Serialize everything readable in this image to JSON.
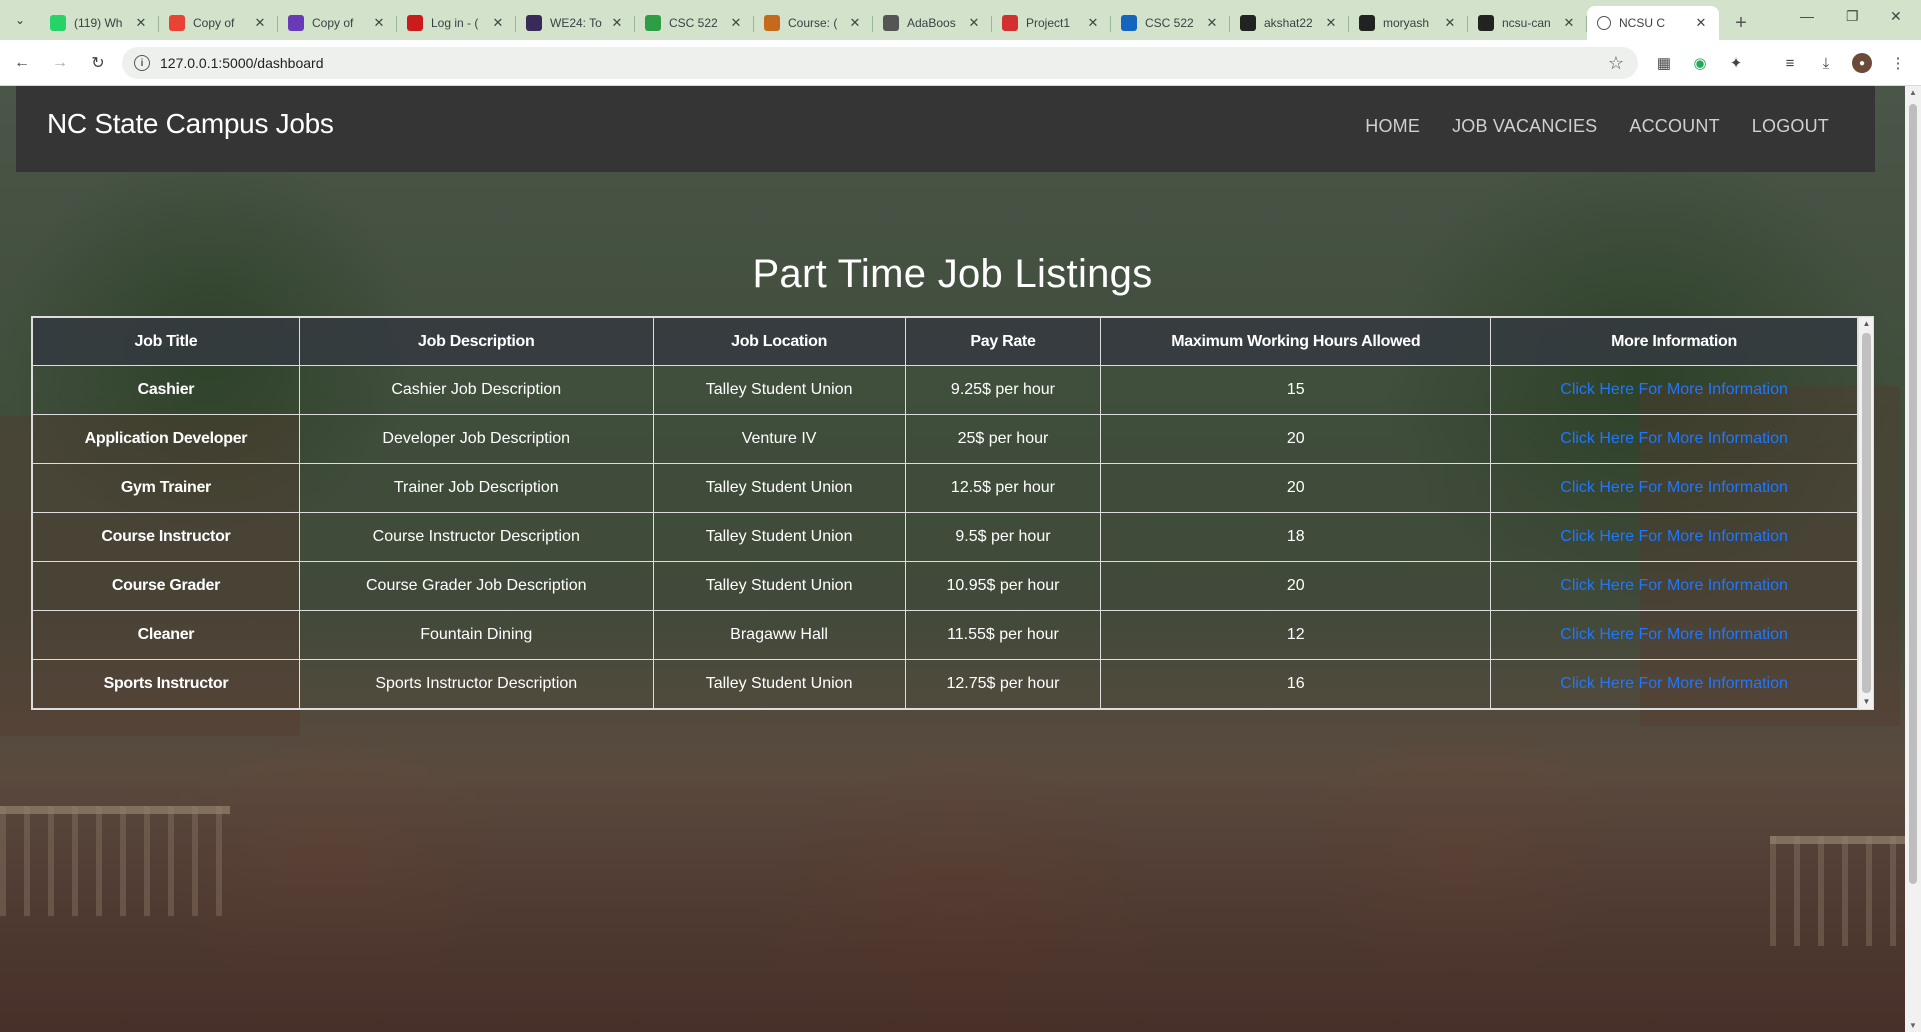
{
  "browser": {
    "tabs": [
      {
        "label": "(119) Wh",
        "icon": "whatsapp-icon",
        "color": "#25d366"
      },
      {
        "label": "Copy of",
        "icon": "gmail-icon",
        "color": "#ea4335"
      },
      {
        "label": "Copy of",
        "icon": "forms-icon",
        "color": "#673ab7"
      },
      {
        "label": "Log in - (",
        "icon": "opera-icon",
        "color": "#cc1b1b"
      },
      {
        "label": "WE24: To",
        "icon": "we24-icon",
        "color": "#3a2a5a"
      },
      {
        "label": "CSC 522",
        "icon": "bookmark-icon",
        "color": "#2e9e44"
      },
      {
        "label": "Course: (",
        "icon": "course-icon",
        "color": "#c46a1a"
      },
      {
        "label": "AdaBoos",
        "icon": "openai-icon",
        "color": "#555555"
      },
      {
        "label": "Project1",
        "icon": "project-icon",
        "color": "#d32f2f"
      },
      {
        "label": "CSC 522",
        "icon": "p-icon",
        "color": "#1565c0"
      },
      {
        "label": "akshat22",
        "icon": "github-icon",
        "color": "#222222"
      },
      {
        "label": "moryash",
        "icon": "github-icon",
        "color": "#222222"
      },
      {
        "label": "ncsu-can",
        "icon": "github-icon",
        "color": "#222222"
      }
    ],
    "active_tab": {
      "label": "NCSU C",
      "icon": "globe-icon"
    },
    "url": "127.0.0.1:5000/dashboard"
  },
  "site": {
    "brand": "NC State Campus Jobs",
    "nav": [
      "HOME",
      "JOB VACANCIES",
      "ACCOUNT",
      "LOGOUT"
    ],
    "heading": "Part Time Job Listings"
  },
  "table": {
    "headers": [
      "Job Title",
      "Job Description",
      "Job Location",
      "Pay Rate",
      "Maximum Working Hours Allowed",
      "More Information"
    ],
    "rows": [
      {
        "title": "Cashier",
        "description": "Cashier Job Description",
        "location": "Talley Student Union",
        "pay": "9.25$ per hour",
        "hours": "15",
        "link": "Click Here For More Information"
      },
      {
        "title": "Application Developer",
        "description": "Developer Job Description",
        "location": "Venture IV",
        "pay": "25$ per hour",
        "hours": "20",
        "link": "Click Here For More Information"
      },
      {
        "title": "Gym Trainer",
        "description": "Trainer Job Description",
        "location": "Talley Student Union",
        "pay": "12.5$ per hour",
        "hours": "20",
        "link": "Click Here For More Information"
      },
      {
        "title": "Course Instructor",
        "description": "Course Instructor Description",
        "location": "Talley Student Union",
        "pay": "9.5$ per hour",
        "hours": "18",
        "link": "Click Here For More Information"
      },
      {
        "title": "Course Grader",
        "description": "Course Grader Job Description",
        "location": "Talley Student Union",
        "pay": "10.95$ per hour",
        "hours": "20",
        "link": "Click Here For More Information"
      },
      {
        "title": "Cleaner",
        "description": "Fountain Dining",
        "location": "Bragaww Hall",
        "pay": "11.55$ per hour",
        "hours": "12",
        "link": "Click Here For More Information"
      },
      {
        "title": "Sports Instructor",
        "description": "Sports Instructor Description",
        "location": "Talley Student Union",
        "pay": "12.75$ per hour",
        "hours": "16",
        "link": "Click Here For More Information"
      }
    ]
  },
  "colors": {
    "navbar": "#353535",
    "link": "#1e77ff",
    "tabstrip": "#d3e3cb"
  }
}
